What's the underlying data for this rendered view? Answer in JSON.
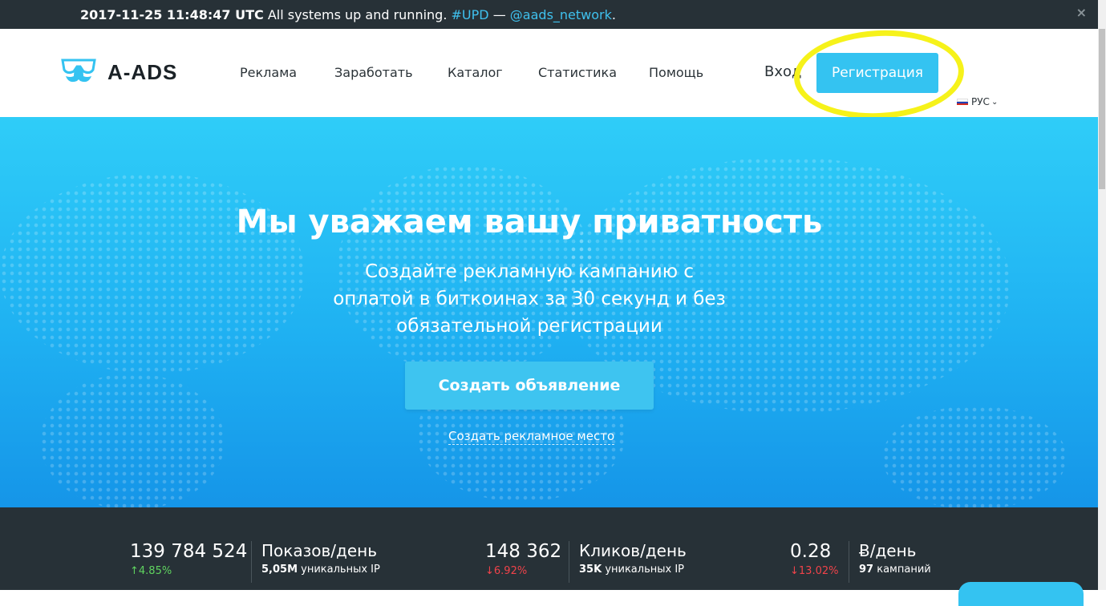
{
  "status_bar": {
    "timestamp": "2017-11-25 11:48:47 UTC",
    "message": "All systems up and running.",
    "tag": "#UPD",
    "dash": "—",
    "handle": "@aads_network",
    "period": ".",
    "close": "×"
  },
  "header": {
    "logo_text": "A-ADS",
    "nav": [
      "Реклама",
      "Заработать",
      "Каталог",
      "Статистика",
      "Помощь"
    ],
    "login": "Вход",
    "register": "Регистрация",
    "language": "РУС",
    "caret": "⌄"
  },
  "hero": {
    "title": "Мы уважаем вашу приватность",
    "subtitle": "Создайте рекламную кампанию с оплатой в биткоинах за 30 секунд и без обязательной регистрации",
    "create_ad": "Создать объявление",
    "create_place": "Создать рекламное место"
  },
  "stats": [
    {
      "value": "139 784 524",
      "change": "4.85%",
      "direction": "up",
      "label": "Показов/день",
      "sub_bold": "5,05M",
      "sub": "уникальных IP"
    },
    {
      "value": "148 362",
      "change": "6.92%",
      "direction": "down",
      "label": "Кликов/день",
      "sub_bold": "35K",
      "sub": "уникальных IP"
    },
    {
      "value": "0.28",
      "change": "13.02%",
      "direction": "down",
      "label": "Ƀ/день",
      "sub_bold": "97",
      "sub": "кампаний"
    }
  ],
  "colors": {
    "accent": "#34c3f1",
    "dark": "#273137",
    "highlight": "#f6f21a",
    "up": "#5fd35f",
    "down": "#f0434a"
  }
}
